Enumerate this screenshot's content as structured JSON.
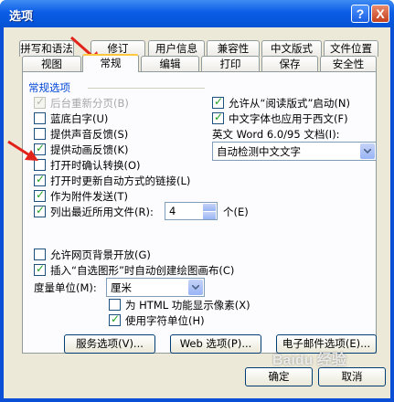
{
  "window": {
    "title": "选项"
  },
  "title_buttons": {
    "help": "?",
    "close": "X"
  },
  "tabs_row1": [
    {
      "label": "拼写和语法"
    },
    {
      "label": "修订"
    },
    {
      "label": "用户信息"
    },
    {
      "label": "兼容性"
    },
    {
      "label": "中文版式"
    },
    {
      "label": "文件位置"
    }
  ],
  "tabs_row2": [
    {
      "label": "视图"
    },
    {
      "label": "常规",
      "selected": true
    },
    {
      "label": "编辑"
    },
    {
      "label": "打印"
    },
    {
      "label": "保存"
    },
    {
      "label": "安全性"
    }
  ],
  "section": {
    "label": "常规选项"
  },
  "left_options": [
    {
      "label": "后台重新分页(B)",
      "checked": true,
      "disabled": true
    },
    {
      "label": "蓝底白字(U)",
      "checked": false
    },
    {
      "label": "提供声音反馈(S)",
      "checked": false
    },
    {
      "label": "提供动画反馈(K)",
      "checked": true
    },
    {
      "label": "打开时确认转换(O)",
      "checked": false
    },
    {
      "label": "打开时更新自动方式的链接(L)",
      "checked": true
    },
    {
      "label": "作为附件发送(T)",
      "checked": true
    },
    {
      "label": "列出最近所用文件(R):",
      "checked": true
    }
  ],
  "recent": {
    "value": "4",
    "unit": "个(E)"
  },
  "right_options": [
    {
      "label": "允许从“阅读版式”启动(N)",
      "checked": true
    },
    {
      "label": "中文字体也应用于西文(F)",
      "checked": true
    }
  ],
  "english_doc": {
    "label": "英文 Word 6.0/95 文档(I):",
    "value": "自动检测中文文字"
  },
  "lower_options": [
    {
      "label": "允许网页背景开放(G)",
      "checked": false
    },
    {
      "label": "插入“自选图形”时自动创建绘图画布(C)",
      "checked": true
    }
  ],
  "measure": {
    "label": "度量单位(M):",
    "value": "厘米"
  },
  "unit_options": [
    {
      "label": "为 HTML 功能显示像素(X)",
      "checked": false
    },
    {
      "label": "使用字符单位(H)",
      "checked": true
    }
  ],
  "buttons": {
    "service": "服务选项(V)...",
    "web": "Web 选项(P)...",
    "email": "电子邮件选项(E)...",
    "ok": "确定",
    "cancel": "取消"
  },
  "watermark": "Baidu 经验",
  "colors": {
    "title_bar": "#0b5ce6",
    "selected_tab_accent": "#ffc83c",
    "annotation_arrow": "#e2231a",
    "check": "#21a121"
  }
}
